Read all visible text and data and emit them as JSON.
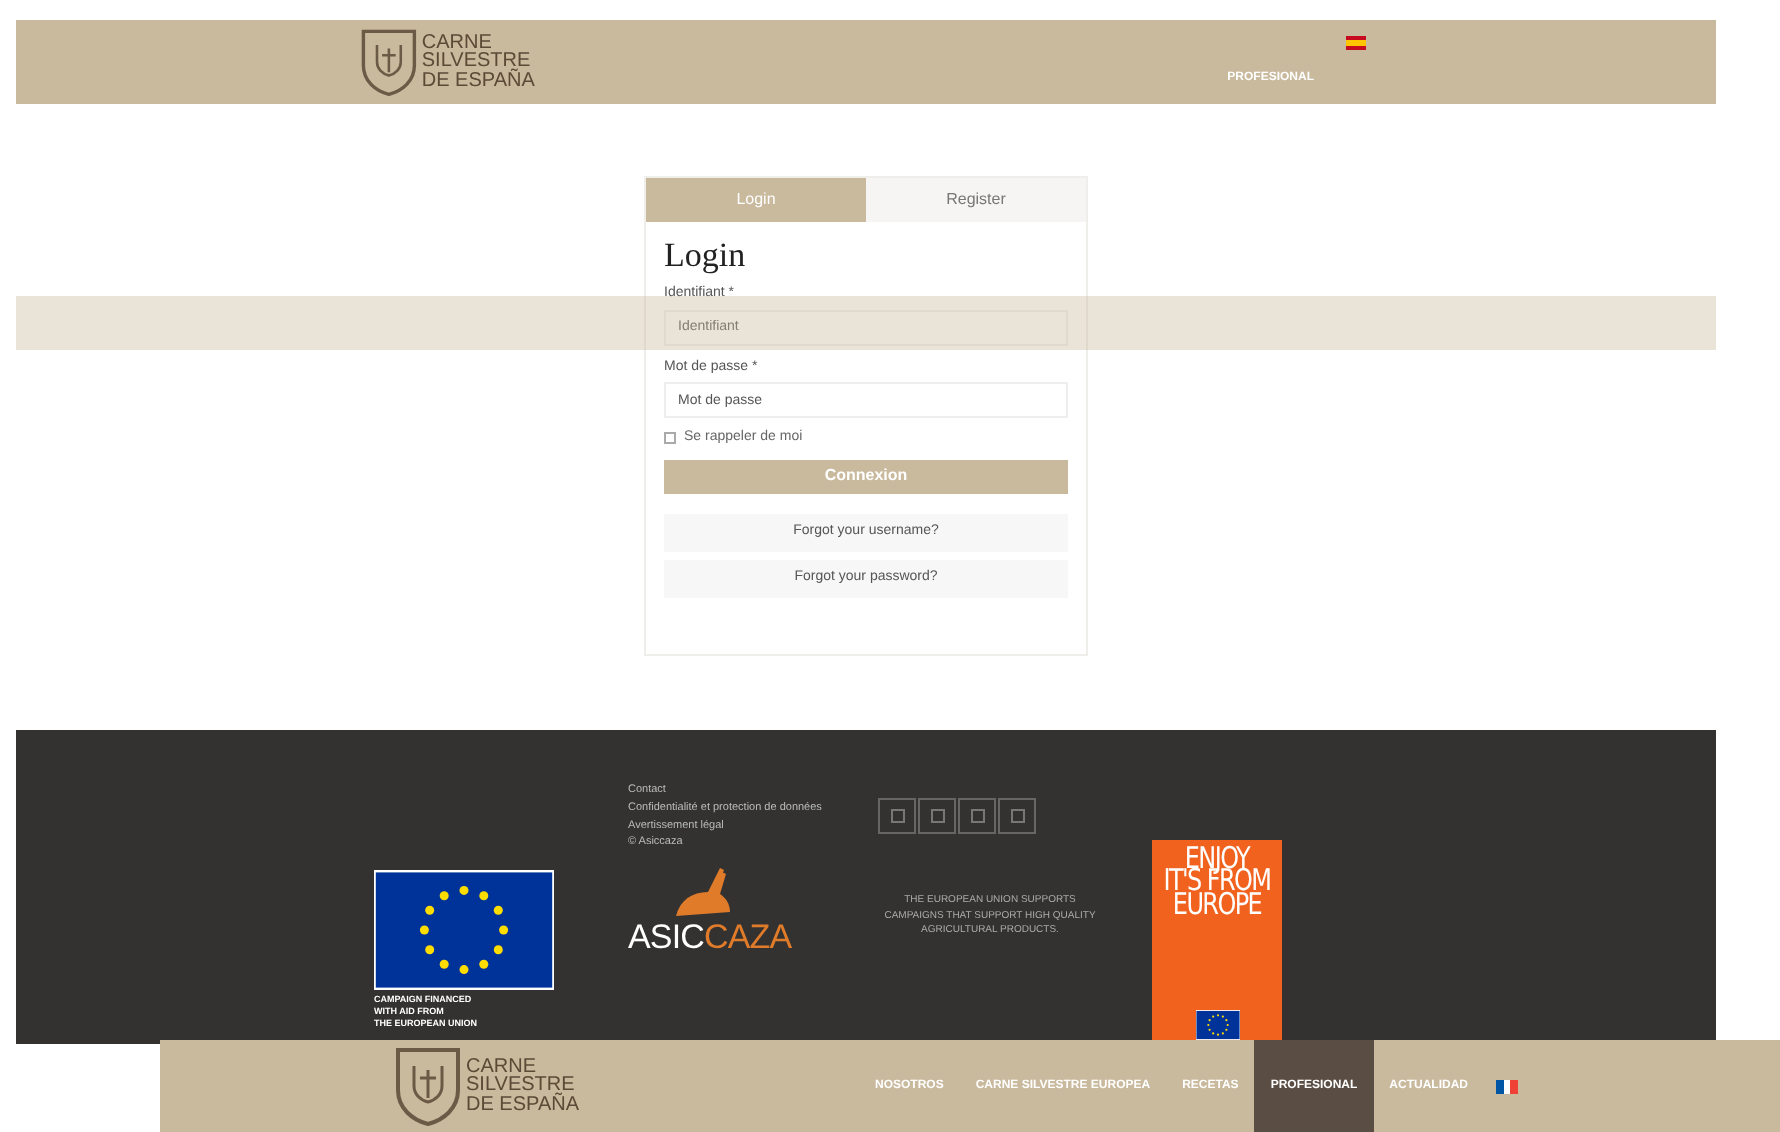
{
  "header": {
    "logo_lines": [
      "CARNE",
      "SILVESTRE",
      "DE ESPAÑA"
    ],
    "nav": [
      {
        "label": "PROFESIONAL",
        "selected": false
      }
    ]
  },
  "login": {
    "tabs": [
      {
        "label": "Login",
        "selected": true
      },
      {
        "label": "Register",
        "selected": false
      }
    ],
    "title": "Login",
    "fields": [
      {
        "label": "Identifiant *",
        "placeholder": "Identifiant"
      },
      {
        "label": "Mot de passe *",
        "placeholder": "Mot de passe"
      }
    ],
    "remember": {
      "label": "Se rappeler de moi",
      "checked": false
    },
    "submit": "Connexion",
    "links": [
      "Forgot your username?",
      "Forgot your password?"
    ]
  },
  "footer": {
    "eu_caption": [
      "CAMPAIGN FINANCED",
      "WITH AID FROM",
      "THE EUROPEAN UNION"
    ],
    "links": [
      "Contact",
      "Confidentialité et protection de données",
      "Avertissement légal",
      "© Asiccaza"
    ],
    "partner_logo": {
      "part1": "ASIC",
      "part2": "CAZA"
    },
    "eu_statement": "THE EUROPEAN UNION SUPPORTS CAMPAIGNS THAT SUPPORT HIGH QUALITY AGRICULTURAL PRODUCTS.",
    "poster_lines": [
      "ENJOY",
      "IT'S FROM",
      "EUROPE"
    ]
  },
  "sticky_nav": {
    "logo_lines": [
      "CARNE",
      "SILVESTRE",
      "DE ESPAÑA"
    ],
    "items": [
      {
        "label": "NOSOTROS",
        "selected": false
      },
      {
        "label": "CARNE SILVESTRE EUROPEA",
        "selected": false
      },
      {
        "label": "RECETAS",
        "selected": false
      },
      {
        "label": "PROFESIONAL",
        "selected": true
      },
      {
        "label": "ACTUALIDAD",
        "selected": false
      }
    ]
  }
}
